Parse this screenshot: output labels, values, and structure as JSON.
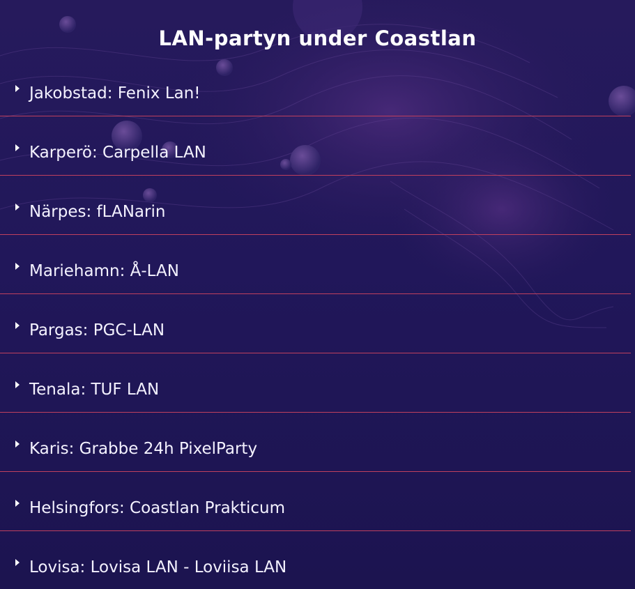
{
  "page": {
    "title": "LAN-partyn under Coastlan"
  },
  "theme": {
    "background": "#1f1650",
    "divider": "#c0405e",
    "text": "#ffffff"
  },
  "accordion": {
    "items": [
      {
        "label": "Jakobstad: Fenix Lan!",
        "icon": "caret-right-icon"
      },
      {
        "label": "Karperö: Carpella LAN",
        "icon": "caret-right-icon"
      },
      {
        "label": "Närpes: fLANarin",
        "icon": "caret-right-icon"
      },
      {
        "label": "Mariehamn: Å-LAN",
        "icon": "caret-right-icon"
      },
      {
        "label": "Pargas: PGC-LAN",
        "icon": "caret-right-icon"
      },
      {
        "label": "Tenala: TUF LAN",
        "icon": "caret-right-icon"
      },
      {
        "label": "Karis: Grabbe 24h PixelParty",
        "icon": "caret-right-icon"
      },
      {
        "label": "Helsingfors: Coastlan Prakticum",
        "icon": "caret-right-icon"
      },
      {
        "label": "Lovisa: Lovisa LAN - Loviisa LAN",
        "icon": "caret-right-icon"
      }
    ]
  }
}
